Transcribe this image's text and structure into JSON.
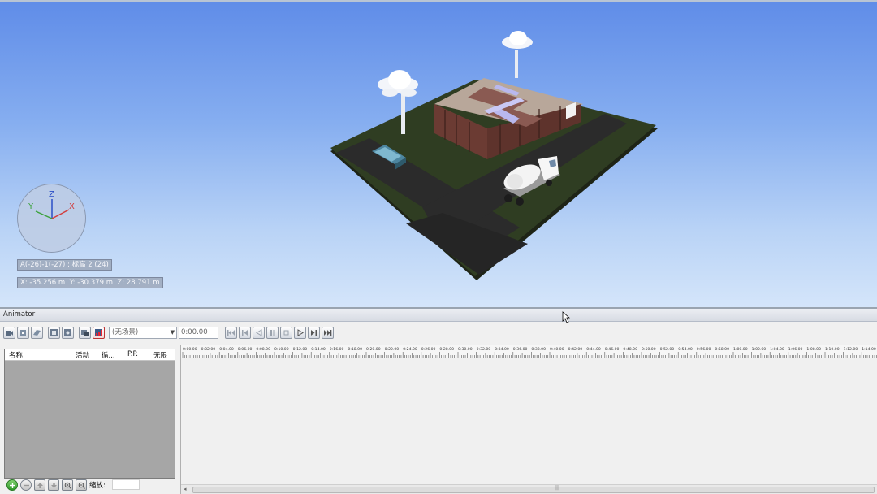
{
  "viewport": {
    "axes": {
      "x": "X",
      "y": "Y",
      "z": "Z"
    },
    "hud_grid": "A(-26)-1(-27) : 标高 2 (24)",
    "hud_coords": "X: -35.256 m  Y: -30.379 m  Z: 28.791 m"
  },
  "animator": {
    "title": "Animator",
    "scene_select": "(无场景)",
    "time_field": "0:00.00",
    "columns": [
      "名称",
      "活动",
      "循...",
      "P.P.",
      "无限"
    ],
    "scale_label": "缩放:",
    "ruler_labels": [
      "0:00.00",
      "0:02.00",
      "0:04.00",
      "0:06.00",
      "0:08.00",
      "0:10.00",
      "0:12.00",
      "0:14.00",
      "0:16.00",
      "0:18.00",
      "0:20.00",
      "0:22.00",
      "0:24.00",
      "0:26.00",
      "0:28.00",
      "0:30.00",
      "0:32.00",
      "0:34.00",
      "0:36.00",
      "0:38.00",
      "0:40.00",
      "0:42.00",
      "0:44.00",
      "0:46.00",
      "0:48.00",
      "0:50.00",
      "0:52.00",
      "0:54.00",
      "0:56.00",
      "0:58.00",
      "1:00.00",
      "1:02.00",
      "1:04.00",
      "1:06.00",
      "1:08.00",
      "1:10.00",
      "1:12.00",
      "1:14.00"
    ]
  },
  "colors": {
    "sky_top": "#5f8ce8",
    "sky_bottom": "#d4e5fa",
    "grass": "#2f3d22",
    "road": "#2b2b2b",
    "wall": "#6b3b33",
    "roof": "#b8a79a",
    "list_bg": "#a6a6a6"
  },
  "icons": {
    "toolbar": [
      "add-camera-icon",
      "add-3d-object-icon",
      "add-section-plane-icon",
      "capture-keyframe-icon",
      "toggle-snapping-icon",
      "scene-stop-icon",
      "active-scene-icon"
    ],
    "playback": [
      "rewind-icon",
      "step-back-icon",
      "reverse-play-icon",
      "pause-icon",
      "stop-icon",
      "play-icon",
      "step-forward-icon",
      "fast-forward-icon"
    ],
    "list_bottom": [
      "add-icon",
      "delete-icon",
      "move-up-icon",
      "move-down-icon",
      "zoom-in-icon",
      "zoom-out-icon"
    ]
  }
}
